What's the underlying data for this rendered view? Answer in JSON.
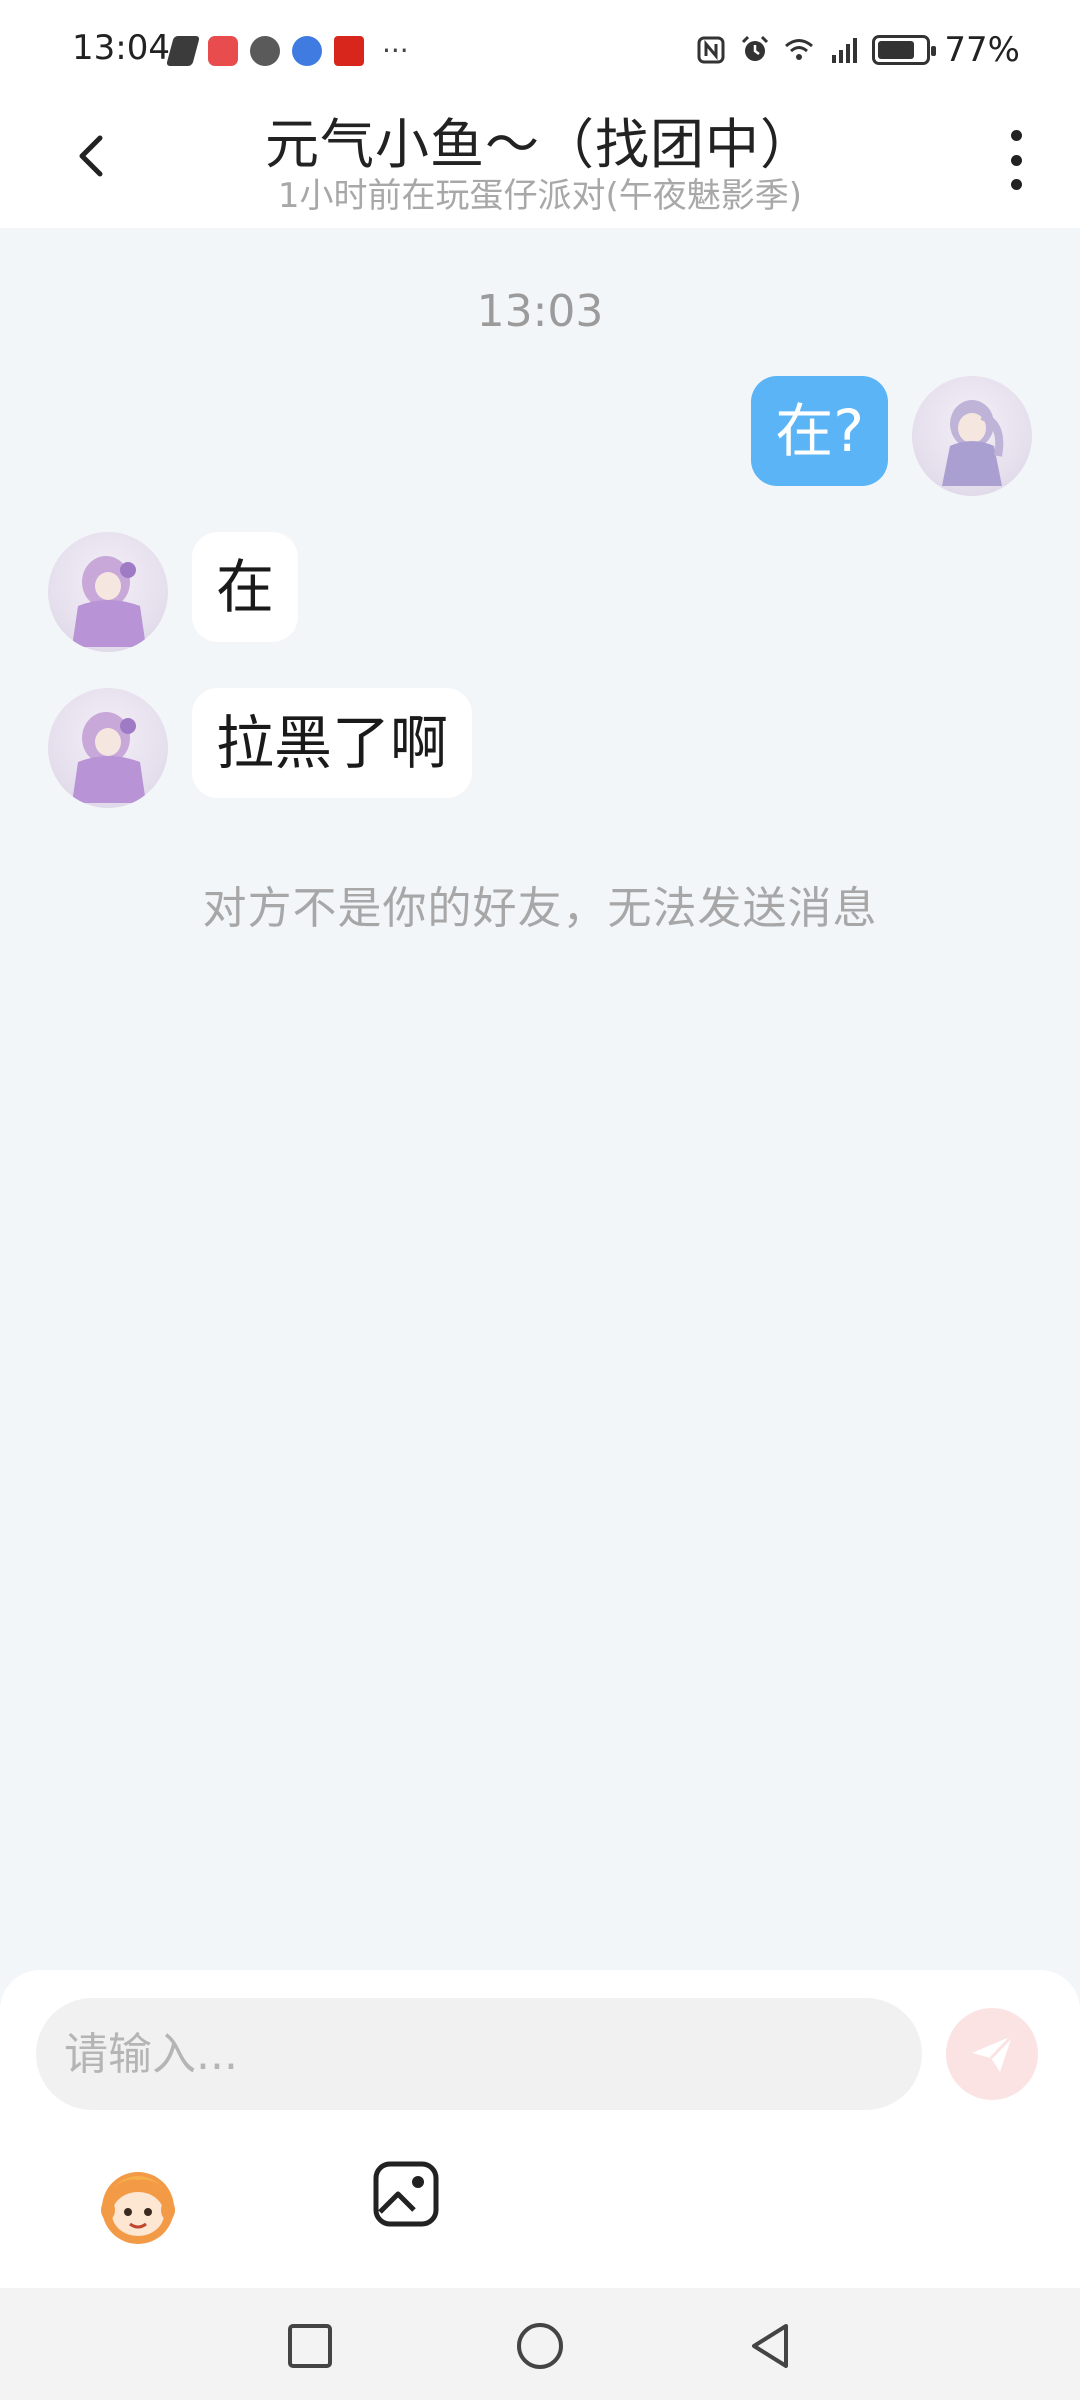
{
  "status_bar": {
    "time": "13:04",
    "notification_icons": [
      "heart-rate-icon",
      "reader-app-icon",
      "voice-app-icon",
      "browser-app-icon",
      "shopping-app-icon"
    ],
    "more_text": "···",
    "system_icons": [
      "nfc-icon",
      "alarm-icon",
      "wifi-icon",
      "5g-signal-icon",
      "battery-icon"
    ],
    "battery_percent": 77,
    "battery_text": "77%"
  },
  "header": {
    "title": "元气小鱼～（找团中）",
    "subtitle": "1小时前在玩蛋仔派对(午夜魅影季)"
  },
  "chat": {
    "timestamp": "13:03",
    "messages": [
      {
        "sender": "me",
        "text": "在?"
      },
      {
        "sender": "them",
        "text": "在"
      },
      {
        "sender": "them",
        "text": "拉黑了啊"
      }
    ],
    "system_notice": "对方不是你的好友，无法发送消息"
  },
  "input": {
    "placeholder": "请输入...",
    "value": ""
  },
  "colors": {
    "my_bubble": "#5ab4f6",
    "their_bubble": "#ffffff",
    "chat_background": "#f3f6f9",
    "send_button": "#fbe3e3"
  }
}
